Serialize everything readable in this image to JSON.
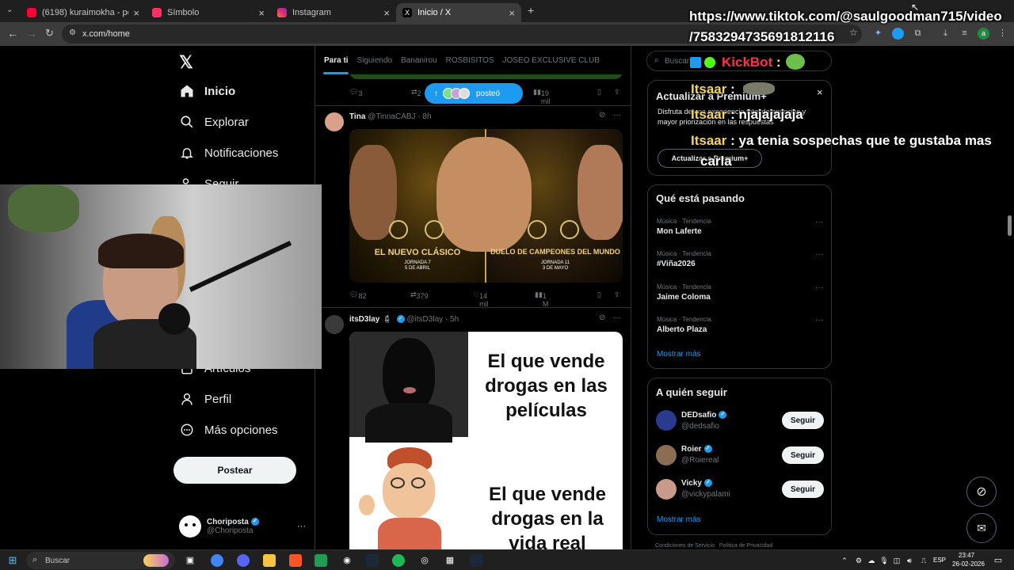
{
  "browser": {
    "tabs": [
      {
        "label": "(6198) kuraimokha - potedex c",
        "color": "#ff0033"
      },
      {
        "label": "Símbolo",
        "color": "#ff2e63"
      },
      {
        "label": "Instagram",
        "color": "#e1306c"
      },
      {
        "label": "Inicio / X",
        "color": "#000000"
      }
    ],
    "new_tab": "+",
    "url": "x.com/home"
  },
  "sidebar": {
    "logo": "𝕏",
    "items": [
      {
        "label": "Inicio",
        "icon": "home-icon"
      },
      {
        "label": "Explorar",
        "icon": "search-icon"
      },
      {
        "label": "Notificaciones",
        "icon": "bell-icon"
      },
      {
        "label": "Seguir",
        "icon": "follow-icon"
      },
      {
        "label": "Artículos",
        "icon": "article-icon"
      },
      {
        "label": "Perfil",
        "icon": "person-icon"
      },
      {
        "label": "Más opciones",
        "icon": "more-circle-icon"
      }
    ],
    "post_button": "Postear",
    "account": {
      "name": "Choriposta",
      "handle": "@Choriposta",
      "more": "···"
    }
  },
  "feed": {
    "tabs": [
      "Para ti",
      "Siguiendo",
      "Bananirou",
      "ROSBISITOS",
      "JOSEO EXCLUSIVE CLUB"
    ],
    "posted_pill": "posteó",
    "tweet0_actions": {
      "replies": "3",
      "retweets": "2",
      "views": "19 mil"
    },
    "tweets": [
      {
        "name": "Tina",
        "handle": "@TinnaCABJ",
        "time": "· 8h",
        "image": {
          "left_title": "EL NUEVO CLÁSICO",
          "left_sub": "JORNADA 7",
          "left_date": "5 DE ABRIL",
          "right_title": "DUELO DE CAMPEONES DEL MUNDO",
          "right_sub": "JORNADA 11",
          "right_date": "3 DE MAYO"
        },
        "actions": {
          "replies": "82",
          "retweets": "379",
          "likes": "14 mil",
          "views": "1 M"
        }
      },
      {
        "name": "itsD3lay",
        "handle": "@itsD3lay",
        "time": "· 5h",
        "meme_top": "El que vende drogas en las películas",
        "meme_bottom": "El que vende drogas en la vida real"
      }
    ]
  },
  "right": {
    "search_placeholder": "Buscar",
    "premium": {
      "title": "Actualizar a Premium+",
      "body": "Disfruta de una experiencia total de anuncios y mayor priorización en las respuestas",
      "button": "Actualizar a Premium+",
      "close": "×"
    },
    "trends": {
      "title": "Qué está pasando",
      "items": [
        {
          "context": "Música · Tendencia",
          "name": "Mon Laferte"
        },
        {
          "context": "Música · Tendencia",
          "name": "#Viña2026"
        },
        {
          "context": "Música · Tendencia",
          "name": "Jaime Coloma"
        },
        {
          "context": "Música · Tendencia",
          "name": "Alberto Plaza"
        }
      ],
      "show_more": "Mostrar más"
    },
    "who_to_follow": {
      "title": "A quién seguir",
      "items": [
        {
          "name": "DEDsafio",
          "handle": "@dedsafio",
          "button": "Seguir"
        },
        {
          "name": "Roier",
          "handle": "@Roiereal",
          "button": "Seguir"
        },
        {
          "name": "Vicky",
          "handle": "@vickypalami",
          "button": "Seguir"
        }
      ],
      "show_more": "Mostrar más"
    },
    "footer": "Condiciones de Servicio   Política de Privacidad"
  },
  "stream_overlay": {
    "tiktok_line1": "https://www.tiktok.com/@saulgoodman715/video",
    "tiktok_line2": "/7583294735691812116",
    "chat": [
      {
        "user": "KickBot",
        "msg": ":"
      },
      {
        "user": "Itsaar",
        "msg": ":"
      },
      {
        "user": "Itsaar",
        "msg": ": njajajajaja"
      },
      {
        "user": "Itsaar",
        "msg": ": ya tenia sospechas que te gustaba mas"
      },
      {
        "user": "",
        "msg": "carla"
      }
    ]
  },
  "taskbar": {
    "search": "Buscar",
    "lang": "ESP",
    "time": "23:47",
    "date": "26-02-2026"
  },
  "colors": {
    "accent": "#1d9bf0",
    "background": "#000000",
    "border": "#2f3336",
    "muted": "#71767b"
  }
}
